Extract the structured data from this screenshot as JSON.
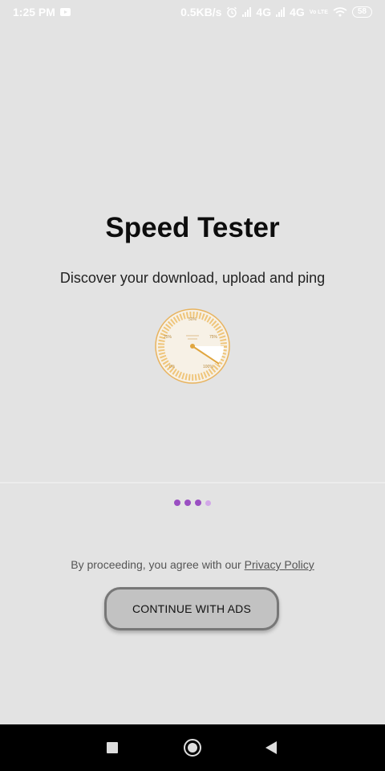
{
  "status_bar": {
    "time": "1:25 PM",
    "net_speed": "0.5KB/s",
    "network1": "4G",
    "network2": "4G",
    "volte": "Vo LTE",
    "battery": "58"
  },
  "onboarding": {
    "title": "Speed Tester",
    "subtitle": "Discover your download, upload and ping",
    "gauge_labels": [
      "0%",
      "25%",
      "50%",
      "75%",
      "100%"
    ],
    "gauge_center_text": "",
    "pager": {
      "total": 4,
      "active_count": 3,
      "active_color": "#9a4fc2",
      "inactive_color": "#d2a8e8"
    }
  },
  "footer": {
    "legal_prefix": "By proceeding, you agree with our ",
    "privacy_link": "Privacy Policy",
    "cta_label": "CONTINUE WITH ADS"
  },
  "nav": {
    "recents_icon": "square-icon",
    "home_icon": "circle-icon",
    "back_icon": "triangle-back-icon"
  }
}
